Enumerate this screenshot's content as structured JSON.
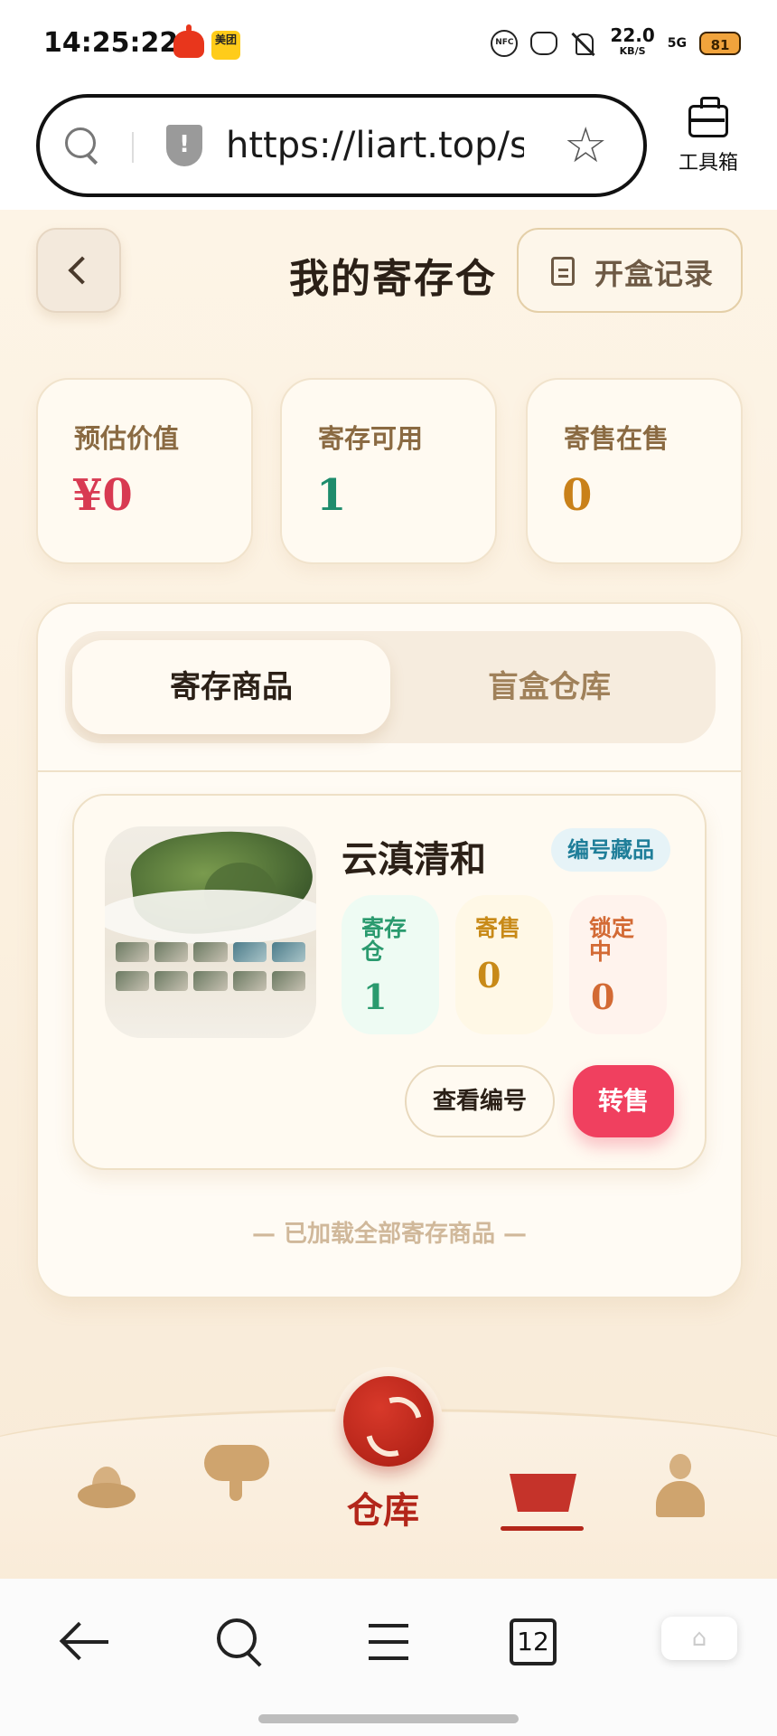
{
  "status_bar": {
    "time": "14:25:22",
    "app2_label": "美团",
    "nfc_label": "NFC",
    "speed_value": "22.0",
    "speed_unit": "KB/S",
    "network": "5G",
    "battery": "81"
  },
  "browser": {
    "url": "https://liart.top/st...",
    "toolbox_label": "工具箱",
    "tab_count": "12",
    "home_glyph": "⌂"
  },
  "header": {
    "title": "我的寄存仓",
    "record_label": "开盒记录"
  },
  "stats": [
    {
      "label": "预估价值",
      "value": "¥0",
      "color": "#d83a52"
    },
    {
      "label": "寄存可用",
      "value": "1",
      "color": "#1e8c6c"
    },
    {
      "label": "寄售在售",
      "value": "0",
      "color": "#c9811a"
    }
  ],
  "tabs": {
    "active": "寄存商品",
    "inactive": "盲盒仓库"
  },
  "item": {
    "name": "云滇清和",
    "tag": "编号藏品",
    "store_label": "寄存仓",
    "store_value": "1",
    "sale_label": "寄售",
    "sale_value": "0",
    "lock_label": "锁定中",
    "lock_value": "0",
    "view_label": "查看编号",
    "sell_label": "转售"
  },
  "list_footer": "— 已加载全部寄存商品 —",
  "tabbar": {
    "center_label": "仓库"
  },
  "colors": {
    "accent_red": "#b3261a",
    "sell_pink": "#f0405f",
    "gold_text": "#8a6a42"
  }
}
